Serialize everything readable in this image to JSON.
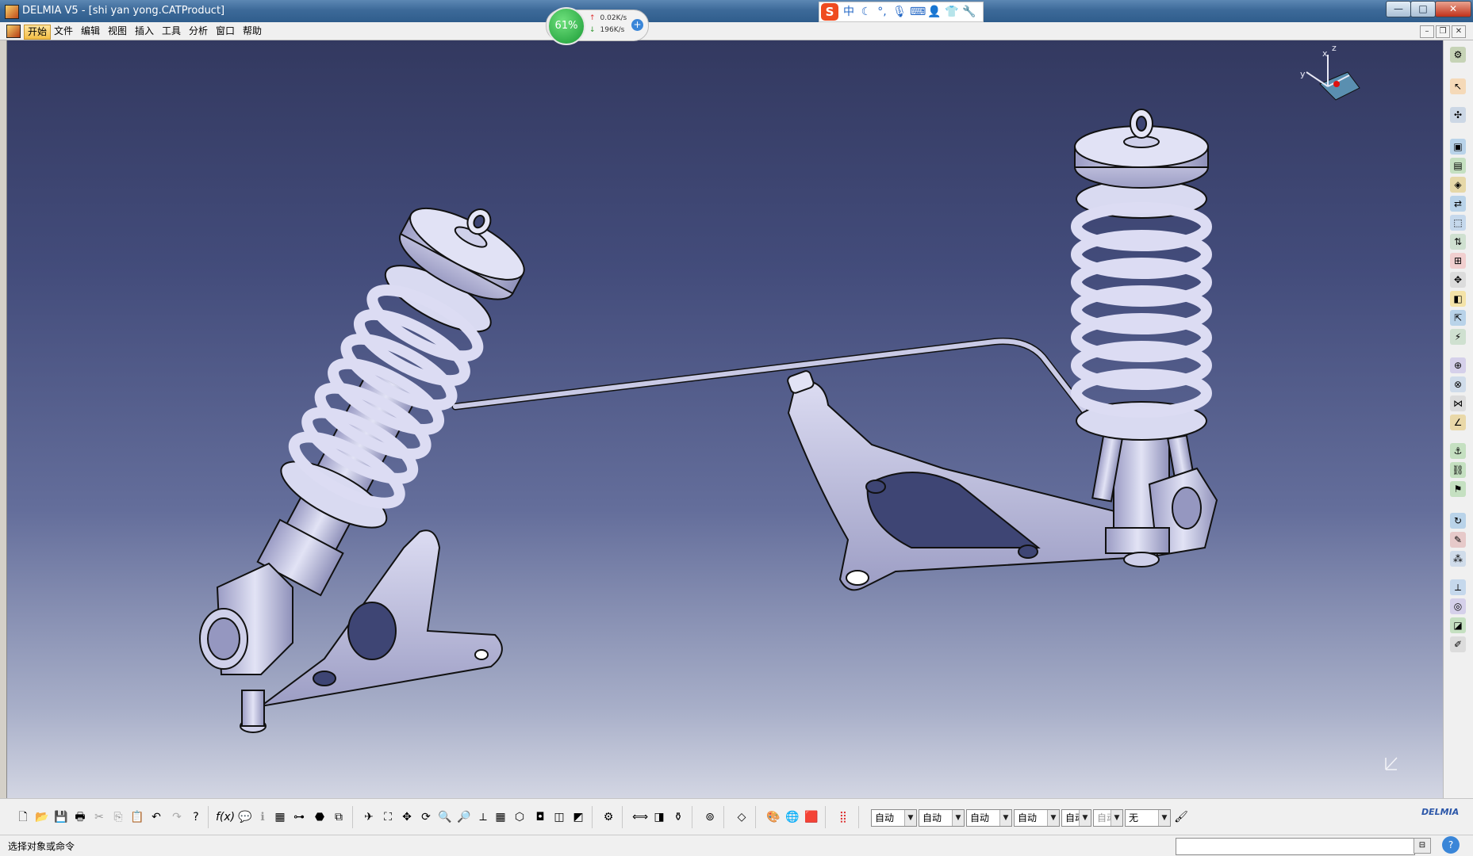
{
  "window": {
    "title": "DELMIA V5 - [shi yan yong.CATProduct]",
    "minimize": "—",
    "maximize": "□",
    "close": "✕"
  },
  "speed_widget": {
    "cpu_percent": "61%",
    "upload": "0.02K/s",
    "download": "196K/s"
  },
  "ime": {
    "logo": "S",
    "mode": "中"
  },
  "menu": {
    "items": [
      "开始",
      "文件",
      "编辑",
      "视图",
      "插入",
      "工具",
      "分析",
      "窗口",
      "帮助"
    ],
    "active_index": 0
  },
  "compass": {
    "x_label": "x",
    "y_label": "y",
    "z_label": "z"
  },
  "bottom_toolbar": {
    "combos": [
      "自动",
      "自动",
      "自动",
      "自动",
      "自动",
      "自动",
      "无"
    ],
    "logo": "DELMIA"
  },
  "status": {
    "message": "选择对象或命令",
    "command_input": ""
  },
  "colors": {
    "viewport_top": "#333960",
    "viewport_bottom": "#d3d6e3",
    "part_fill": "#cfd0ea",
    "part_stroke": "#111111"
  }
}
